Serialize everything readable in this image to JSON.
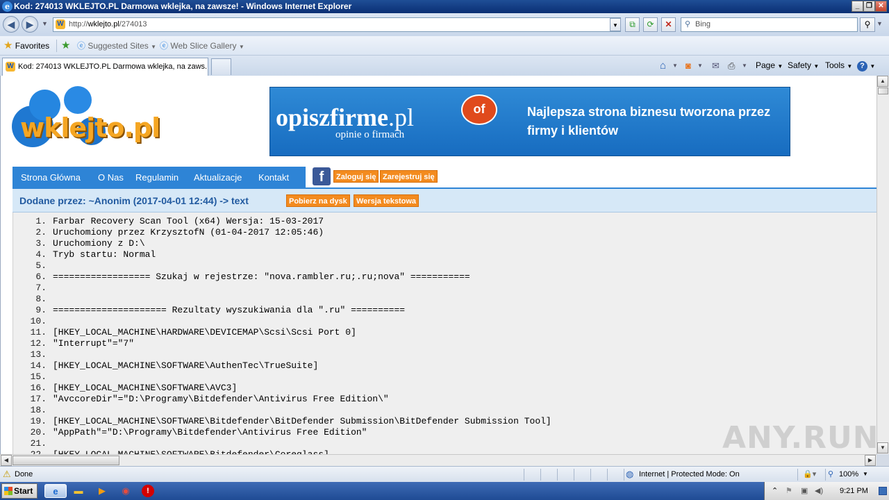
{
  "window": {
    "title": "Kod: 274013 WKLEJTO.PL Darmowa wklejka, na zawsze! - Windows Internet Explorer",
    "minimize_glyph": "_",
    "maximize_glyph": "❐",
    "close_glyph": "✕"
  },
  "address_bar": {
    "url_prefix": "http://",
    "url_host": "wklejto.pl",
    "url_path": "/274013",
    "search_placeholder": "Bing"
  },
  "favorites_bar": {
    "favorites_label": "Favorites",
    "suggested_sites": "Suggested Sites",
    "web_slice_gallery": "Web Slice Gallery"
  },
  "tab": {
    "title": "Kod: 274013 WKLEJTO.PL Darmowa wklejka, na zaws..."
  },
  "command_bar": {
    "page": "Page",
    "safety": "Safety",
    "tools": "Tools",
    "help": "?"
  },
  "site": {
    "logo_text": "wklejto.pl",
    "banner": {
      "brand_main": "opiszfirme",
      "brand_tld": ".pl",
      "bubble": "of",
      "tagline": "opinie o firmach",
      "slogan": "Najlepsza strona biznesu tworzona przez firmy i klientów"
    },
    "nav": [
      "Strona Główna",
      "O Nas",
      "Regulamin",
      "Aktualizacje",
      "Kontakt"
    ],
    "login": "Zaloguj się",
    "register": "Zarejestruj się",
    "info": "Dodane przez: ~Anonim (2017-04-01 12:44) -> text",
    "download": "Pobierz na dysk",
    "text_version": "Wersja tekstowa"
  },
  "code_lines": [
    {
      "num": "1.",
      "text": "Farbar Recovery Scan Tool (x64) Wersja: 15-03-2017"
    },
    {
      "num": "2.",
      "text": "Uruchomiony przez KrzysztofN (01-04-2017 12:05:46)"
    },
    {
      "num": "3.",
      "text": "Uruchomiony z D:\\"
    },
    {
      "num": "4.",
      "text": "Tryb startu: Normal"
    },
    {
      "num": "5.",
      "text": ""
    },
    {
      "num": "6.",
      "text": "================== Szukaj w rejestrze: \"nova.rambler.ru;.ru;nova\" ==========="
    },
    {
      "num": "7.",
      "text": ""
    },
    {
      "num": "8.",
      "text": ""
    },
    {
      "num": "9.",
      "text": "===================== Rezultaty wyszukiwania dla \".ru\" =========="
    },
    {
      "num": "10.",
      "text": ""
    },
    {
      "num": "11.",
      "text": "[HKEY_LOCAL_MACHINE\\HARDWARE\\DEVICEMAP\\Scsi\\Scsi Port 0]"
    },
    {
      "num": "12.",
      "text": "\"Interrupt\"=\"7\""
    },
    {
      "num": "13.",
      "text": ""
    },
    {
      "num": "14.",
      "text": "[HKEY_LOCAL_MACHINE\\SOFTWARE\\AuthenTec\\TrueSuite]"
    },
    {
      "num": "15.",
      "text": ""
    },
    {
      "num": "16.",
      "text": "[HKEY_LOCAL_MACHINE\\SOFTWARE\\AVC3]"
    },
    {
      "num": "17.",
      "text": "\"AvccoreDir\"=\"D:\\Programy\\Bitdefender\\Antivirus Free Edition\\\""
    },
    {
      "num": "18.",
      "text": ""
    },
    {
      "num": "19.",
      "text": "[HKEY_LOCAL_MACHINE\\SOFTWARE\\Bitdefender\\BitDefender Submission\\BitDefender Submission Tool]"
    },
    {
      "num": "20.",
      "text": "\"AppPath\"=\"D:\\Programy\\Bitdefender\\Antivirus Free Edition\""
    },
    {
      "num": "21.",
      "text": ""
    },
    {
      "num": "22.",
      "text": "[HKEY_LOCAL_MACHINE\\SOFTWARE\\Bitdefender\\Coreglass]"
    }
  ],
  "status_bar": {
    "status": "Done",
    "zone": "Internet | Protected Mode: On",
    "zoom": "100%"
  },
  "taskbar": {
    "start": "Start",
    "time": "9:21 PM"
  },
  "watermark": "ANY.RUN",
  "colors": {
    "nav_blue": "#2e84d6",
    "orange_button": "#f38b1f",
    "info_bg": "#d6e8f7",
    "code_bg": "#efefef"
  }
}
